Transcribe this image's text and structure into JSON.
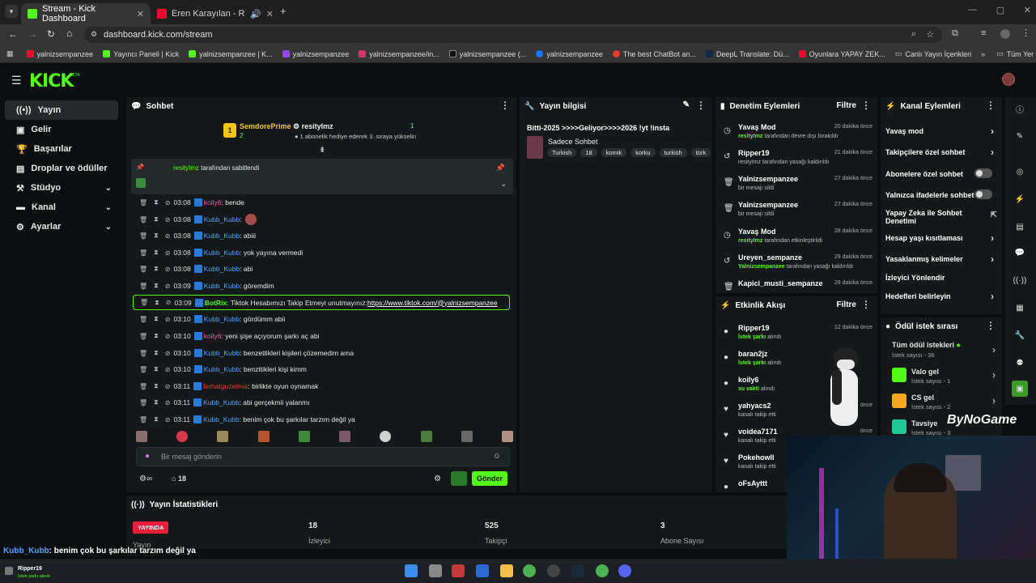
{
  "browser": {
    "tabs": [
      {
        "title": "Stream - Kick Dashboard",
        "active": true
      },
      {
        "title": "Eren Karayılan - Rüyalara Sı",
        "active": false
      }
    ],
    "url": "dashboard.kick.com/stream",
    "bookmarks": [
      "yalnizsempanzee",
      "Yayıncı Paneli | Kick",
      "yalnizsempanzee | K...",
      "yalnizsempanzee",
      "yalnizsempanzee/in...",
      "yalnizsempanzee (...",
      "yalnizsempanzee",
      "The best ChatBot an...",
      "DeepL Translate: Dü...",
      "Oyunlara YAPAY ZEK...",
      "Canlı Yayın İçerikleri"
    ],
    "all_bookmarks": "Tüm Yer İşaretleri"
  },
  "brand": {
    "logo": "KICK",
    "beta": "BETA",
    "accent": "#53fc18"
  },
  "sidebar": {
    "items": [
      {
        "label": "Yayın",
        "icon": "broadcast-icon"
      },
      {
        "label": "Gelir",
        "icon": "money-icon"
      },
      {
        "label": "Başarılar",
        "icon": "trophy-icon"
      },
      {
        "label": "Droplar ve ödüller",
        "icon": "gift-icon"
      },
      {
        "label": "Stüdyo",
        "icon": "studio-icon"
      },
      {
        "label": "Kanal",
        "icon": "channel-icon"
      },
      {
        "label": "Ayarlar",
        "icon": "gear-icon"
      }
    ]
  },
  "chat": {
    "title": "Sohbet",
    "gifter": {
      "rank": "1",
      "name": "SemdorePrime",
      "count": "2",
      "recipient": "resityImz",
      "recipient_count": "1",
      "text": "1 abonelik hediye ederek 3. sıraya yükselin"
    },
    "pinned": {
      "user": "resityImz",
      "text": "tarafından sabitlendi"
    },
    "messages": [
      {
        "time": "03:08",
        "user": "koily6",
        "cls": "u-koily",
        "text": ": bende"
      },
      {
        "time": "03:08",
        "user": "Kubb_Kubb",
        "cls": "u-kubb",
        "text": ":"
      },
      {
        "time": "03:08",
        "user": "Kubb_Kubb",
        "cls": "u-kubb",
        "text": ": abiii"
      },
      {
        "time": "03:08",
        "user": "Kubb_Kubb",
        "cls": "u-kubb",
        "text": ": yok yayına vermedi"
      },
      {
        "time": "03:08",
        "user": "Kubb_Kubb",
        "cls": "u-kubb",
        "text": ": abi"
      },
      {
        "time": "03:09",
        "user": "Kubb_Kubb",
        "cls": "u-kubb",
        "text": ": göremdim"
      },
      {
        "time": "03:09",
        "user": "BotRix",
        "cls": "u-bot",
        "text": ": Tiktok Hesabımızı Takip Etmeyi unutmayınız: ",
        "link": "https://www.tiktok.com/@yalnizsempanzee"
      },
      {
        "time": "03:10",
        "user": "Kubb_Kubb",
        "cls": "u-kubb",
        "text": ": gördümm abii"
      },
      {
        "time": "03:10",
        "user": "koily6",
        "cls": "u-koily",
        "text": ": yeni şişe açıyorum şarkı aç abi"
      },
      {
        "time": "03:10",
        "user": "Kubb_Kubb",
        "cls": "u-kubb",
        "text": ": benzettikleri kişileri çözemedim ama"
      },
      {
        "time": "03:10",
        "user": "Kubb_Kubb",
        "cls": "u-kubb",
        "text": ": benzttikleri kişi kimm"
      },
      {
        "time": "03:11",
        "user": "ferhatguzelmis",
        "cls": "u-ferhat",
        "text": ": birlikte oyun oynamak"
      },
      {
        "time": "03:11",
        "user": "Kubb_Kubb",
        "cls": "u-kubb",
        "text": ": abi gerçekmii yalanmı"
      },
      {
        "time": "03:11",
        "user": "Kubb_Kubb",
        "cls": "u-kubb",
        "text": ": benim çok bu şarkılar tarzım değil ya"
      }
    ],
    "input_placeholder": "Bir mesaj gönderin",
    "viewer_count": "18",
    "send": "Gönder"
  },
  "stream_info": {
    "title": "Yayın bilgisi",
    "stream_title": "Bitti-2025 >>>>Geliyor>>>>2026 !yt !insta",
    "category": "Sadece Sohbet",
    "tags": [
      "Turkish",
      "18",
      "komik",
      "korku",
      "turkish",
      "türk"
    ]
  },
  "mod_actions": {
    "title": "Denetim Eylemleri",
    "filter": "Filtre",
    "items": [
      {
        "name": "Yavaş Mod",
        "by": "resityImz",
        "sub": "tarafından devre dışı bırakıldı",
        "time": "20 dakika önce",
        "icon": "clock-icon"
      },
      {
        "name": "Ripper19",
        "by": "",
        "sub": "resityImz tarafından yasağı kaldırıldı",
        "time": "21 dakika önce",
        "icon": "undo-icon"
      },
      {
        "name": "Yalnizsempanzee",
        "by": "",
        "sub": "bir mesajı sildi",
        "time": "27 dakika önce",
        "icon": "trash-icon"
      },
      {
        "name": "Yalnizsempanzee",
        "by": "",
        "sub": "bir mesajı sildi",
        "time": "27 dakika önce",
        "icon": "trash-icon"
      },
      {
        "name": "Yavaş Mod",
        "by": "resityImz",
        "sub": "tarafından etkinleştirildi",
        "time": "28 dakika önce",
        "icon": "clock-icon"
      },
      {
        "name": "Ureyen_sempanze",
        "by": "Yalnizsempanzee",
        "sub": "tarafından yasağı kaldırıldı",
        "time": "29 dakika önce",
        "icon": "undo-icon"
      },
      {
        "name": "Kapici_musti_sempanze",
        "by": "",
        "sub": "",
        "time": "29 dakika önce",
        "icon": "trash-icon"
      }
    ]
  },
  "activity": {
    "title": "Etkinlik Akışı",
    "filter": "Filtre",
    "items": [
      {
        "name": "Ripper19",
        "sub": "İstek şarkı",
        "sub2": "alındı",
        "time": "12 dakika önce"
      },
      {
        "name": "baran2jz",
        "sub": "İstek şarkı",
        "sub2": "alındı",
        "time": ""
      },
      {
        "name": "koily6",
        "sub": "su vakti",
        "sub2": "alındı",
        "time": ""
      },
      {
        "name": "yahyacs2",
        "sub": "kanalı takip etti",
        "sub2": "",
        "time": "önce"
      },
      {
        "name": "voidea7171",
        "sub": "kanalı takip etti",
        "sub2": "",
        "time": "önce"
      },
      {
        "name": "Pokehowll",
        "sub": "kanalı takip etti",
        "sub2": "",
        "time": ""
      },
      {
        "name": "oFsAyttt",
        "sub": "",
        "sub2": "",
        "time": ""
      }
    ]
  },
  "channel_actions": {
    "title": "Kanal Eylemleri",
    "items": [
      {
        "label": "Yavaş mod",
        "kind": "arrow"
      },
      {
        "label": "Takipçilere özel sohbet",
        "kind": "arrow"
      },
      {
        "label": "Abonelere özel sohbet",
        "kind": "toggle"
      },
      {
        "label": "Yalnızca ifadelerle sohbet",
        "kind": "toggle"
      },
      {
        "label": "Yapay Zeka ile Sohbet Denetimi",
        "kind": "ext"
      },
      {
        "label": "Hesap yaşı kısıtlaması",
        "kind": "arrow"
      },
      {
        "label": "Yasaklanmış kelimeler",
        "kind": "arrow"
      },
      {
        "label": "İzleyici Yönlendir",
        "kind": "none"
      },
      {
        "label": "Hedefleri belirleyin",
        "kind": "arrow"
      }
    ]
  },
  "rewards": {
    "title": "Ödül istek sırası",
    "all": {
      "label": "Tüm ödül istekleri",
      "sub": "İstek sayısı - 36"
    },
    "items": [
      {
        "label": "Valo gel",
        "sub": "İstek sayısı - 1",
        "color": "#53fc18"
      },
      {
        "label": "CS gel",
        "sub": "İstek sayısı - 2",
        "color": "#f5a623"
      },
      {
        "label": "Tavsiye",
        "sub": "İstek sayısı - 3",
        "color": "#20c997"
      }
    ]
  },
  "stats": {
    "title": "Yayın İstatistikleri",
    "live": "YAYINDA",
    "live_label": "Yayın",
    "viewers": "18",
    "viewers_label": "İzleyici",
    "followers": "525",
    "followers_label": "Takipçi",
    "subs": "3",
    "subs_label": "Abone Sayısı"
  },
  "overlay": {
    "chat_user": "Kubb_Kubb",
    "chat_text": ": benim çok bu şarkılar tarzım değil ya",
    "alert_user": "Ripper19",
    "alert_text": "İstek şarkı alındı",
    "watermark": "ByNoGame"
  }
}
